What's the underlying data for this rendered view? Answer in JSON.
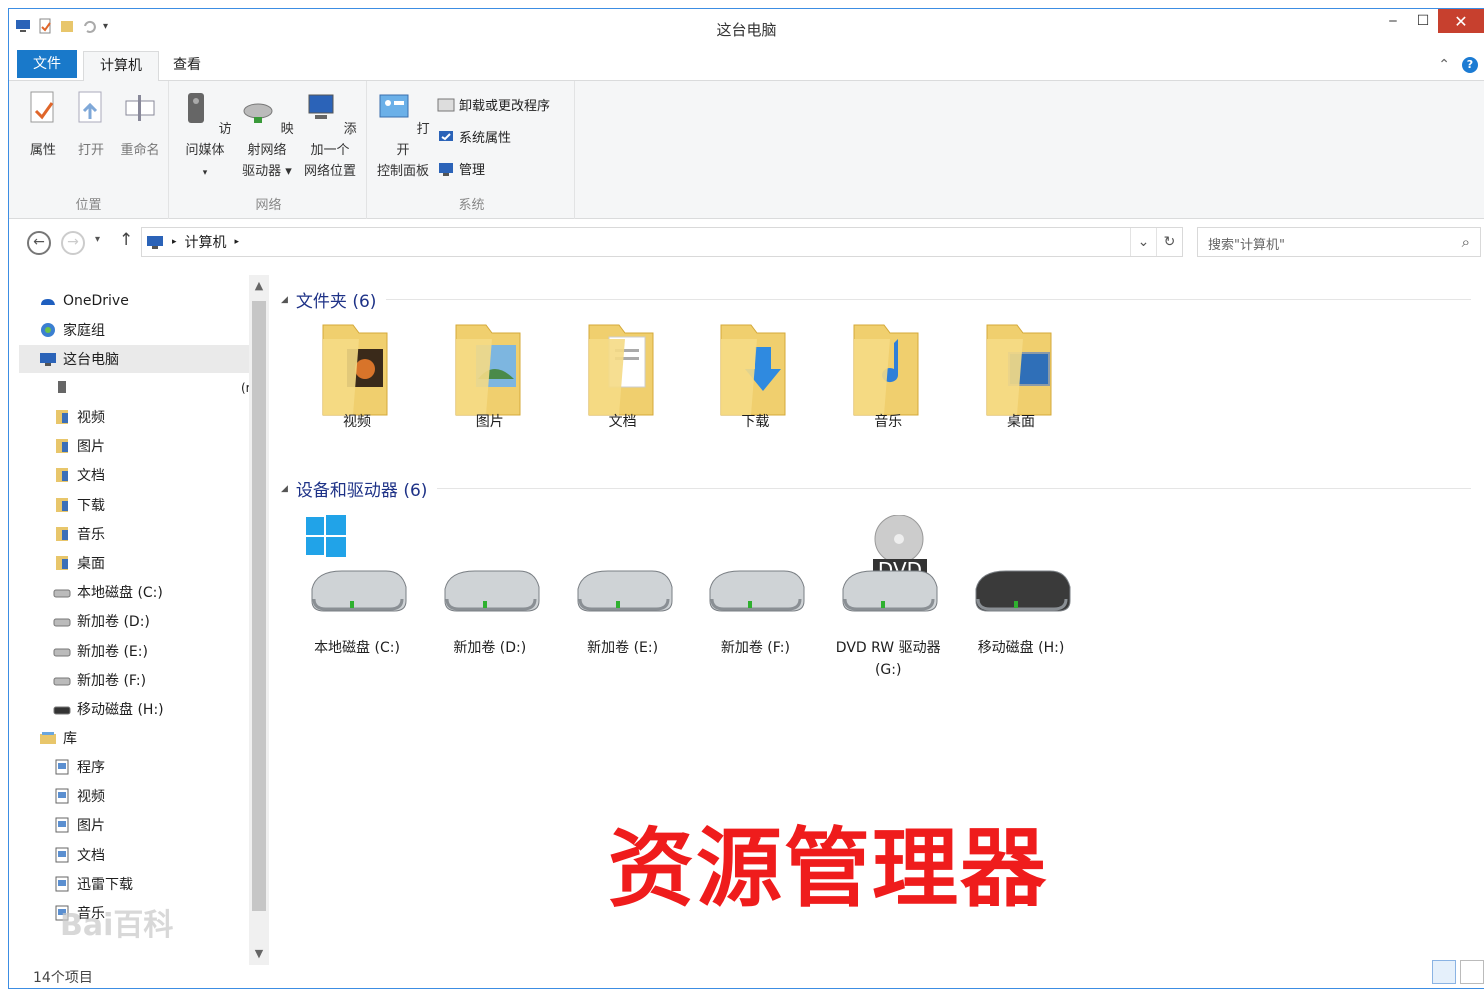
{
  "window": {
    "title": "这台电脑"
  },
  "ribbon_tabs": {
    "file": "文件",
    "computer": "计算机",
    "view": "查看"
  },
  "ribbon": {
    "location": {
      "label": "位置",
      "properties": "属性",
      "open": "打开",
      "rename": "重命名"
    },
    "network": {
      "label": "网络",
      "media": "访问媒体",
      "map_drive_1": "映射网络",
      "map_drive_2": "驱动器",
      "add_loc_1": "添加一个",
      "add_loc_2": "网络位置"
    },
    "system": {
      "label": "系统",
      "open_cp_1": "打开",
      "open_cp_2": "控制面板",
      "uninstall": "卸载或更改程序",
      "sys_props": "系统属性",
      "manage": "管理"
    }
  },
  "address": {
    "crumb": "计算机",
    "search_placeholder": "搜索\"计算机\""
  },
  "nav": {
    "onedrive": "OneDrive",
    "homegroup": "家庭组",
    "this_pc": "这台电脑",
    "overflow": "(r",
    "pc_items": [
      "视频",
      "图片",
      "文档",
      "下载",
      "音乐",
      "桌面",
      "本地磁盘 (C:)",
      "新加卷 (D:)",
      "新加卷 (E:)",
      "新加卷 (F:)",
      "移动磁盘 (H:)"
    ],
    "library": "库",
    "lib_items": [
      "程序",
      "视频",
      "图片",
      "文档",
      "迅雷下载",
      "音乐"
    ]
  },
  "sections": {
    "folders": "文件夹 (6)",
    "drives": "设备和驱动器 (6)"
  },
  "folders": [
    "视频",
    "图片",
    "文档",
    "下载",
    "音乐",
    "桌面"
  ],
  "drives": [
    "本地磁盘 (C:)",
    "新加卷 (D:)",
    "新加卷 (E:)",
    "新加卷 (F:)",
    "DVD RW 驱动器 (G:)",
    "移动磁盘 (H:)"
  ],
  "dvd_label": "DVD",
  "status": {
    "count": "14个项目"
  },
  "caption": "资源管理器",
  "watermark": "Bai百科",
  "colors": {
    "accent": "#1979ca",
    "caption": "#ef1c1c",
    "section": "#1e3287"
  }
}
